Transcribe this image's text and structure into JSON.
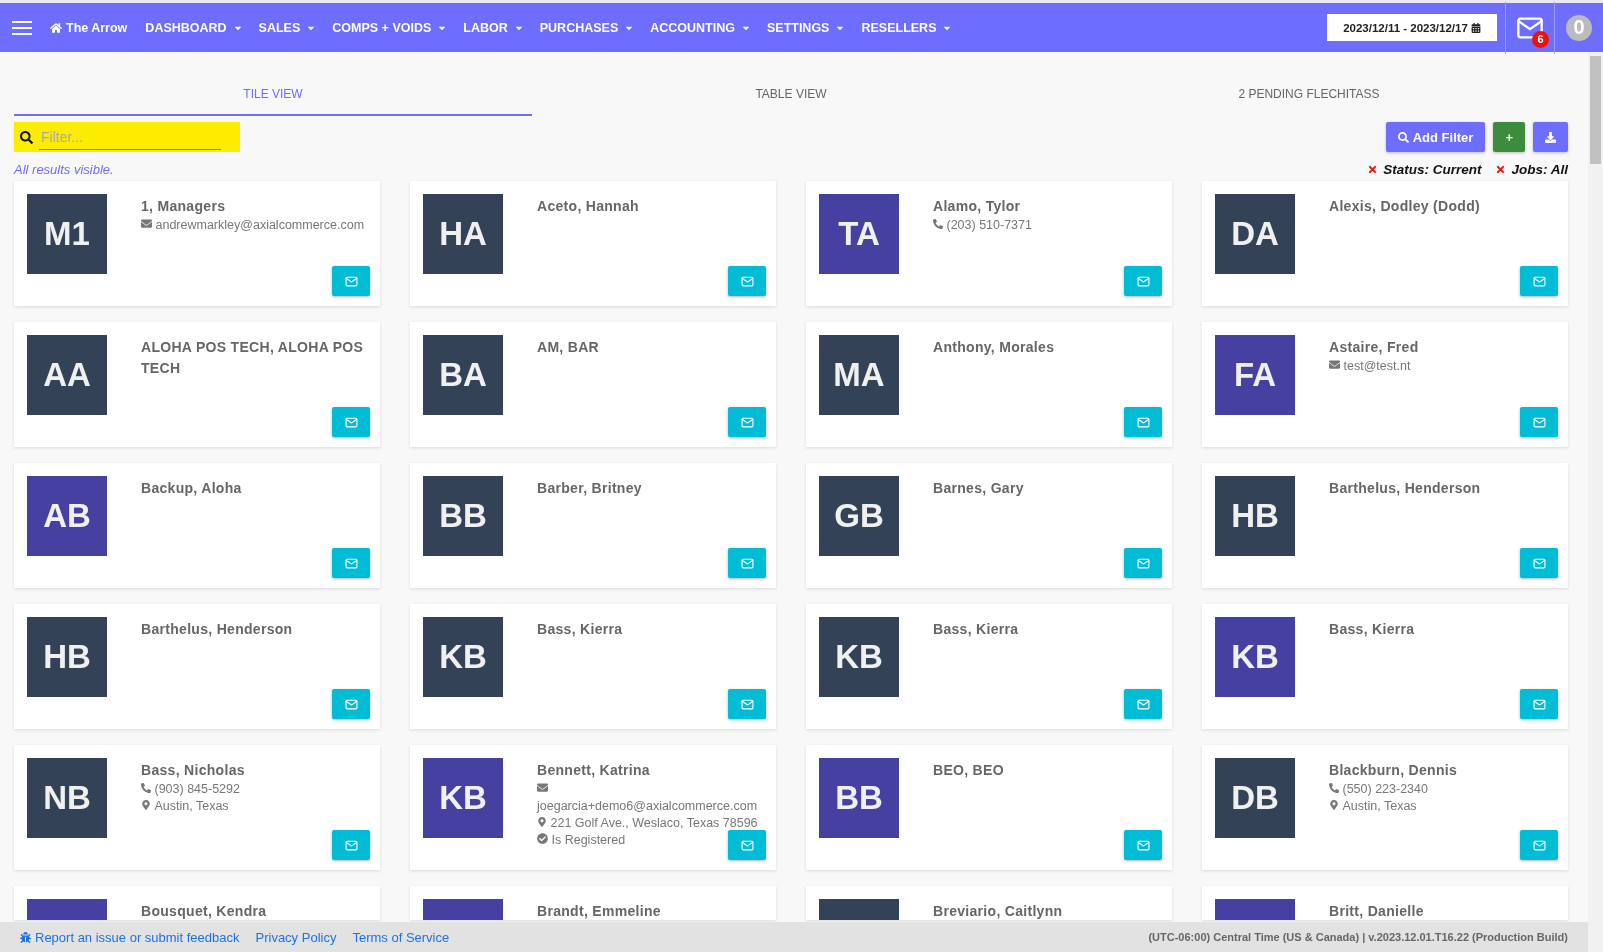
{
  "navbar": {
    "brand": "The Arrow",
    "menus": [
      {
        "label": "DASHBOARD"
      },
      {
        "label": "SALES"
      },
      {
        "label": "COMPS + VOIDS"
      },
      {
        "label": "LABOR"
      },
      {
        "label": "PURCHASES"
      },
      {
        "label": "ACCOUNTING"
      },
      {
        "label": "SETTINGS"
      },
      {
        "label": "RESELLERS"
      }
    ],
    "date_range": "2023/12/11 - 2023/12/17",
    "message_count": "6",
    "user_initial": "0"
  },
  "tabs": [
    {
      "label": "TILE VIEW",
      "selected": true
    },
    {
      "label": "TABLE VIEW",
      "selected": false
    },
    {
      "label": "2 PENDING FLECHITASS",
      "selected": false
    }
  ],
  "filter": {
    "placeholder": "Filter..."
  },
  "toolbar": {
    "add_filter": "Add Filter",
    "add": "+"
  },
  "results_note": "All results visible.",
  "active_filters": [
    "Status: Current",
    "Jobs: All"
  ],
  "tiles": [
    {
      "initials": "M1",
      "name": "1, Managers",
      "color": "#344258",
      "details": [
        {
          "kind": "email",
          "text": "andrewmarkley@axialcommerce.com"
        }
      ]
    },
    {
      "initials": "HA",
      "name": "Aceto, Hannah",
      "color": "#344258"
    },
    {
      "initials": "TA",
      "name": "Alamo, Tylor",
      "color": "#4640a0",
      "details": [
        {
          "kind": "phone",
          "text": "(203) 510-7371"
        }
      ]
    },
    {
      "initials": "DA",
      "name": "Alexis, Dodley (Dodd)",
      "color": "#344258"
    },
    {
      "initials": "AA",
      "name": "ALOHA POS TECH, ALOHA POS TECH",
      "color": "#344258"
    },
    {
      "initials": "BA",
      "name": "AM, BAR",
      "color": "#344258"
    },
    {
      "initials": "MA",
      "name": "Anthony, Morales",
      "color": "#344258"
    },
    {
      "initials": "FA",
      "name": "Astaire, Fred",
      "color": "#4640a0",
      "details": [
        {
          "kind": "email",
          "text": "test@test.nt"
        }
      ]
    },
    {
      "initials": "AB",
      "name": "Backup, Aloha",
      "color": "#4640a0"
    },
    {
      "initials": "BB",
      "name": "Barber, Britney",
      "color": "#344258"
    },
    {
      "initials": "GB",
      "name": "Barnes, Gary",
      "color": "#344258"
    },
    {
      "initials": "HB",
      "name": "Barthelus, Henderson",
      "color": "#344258"
    },
    {
      "initials": "HB",
      "name": "Barthelus, Henderson",
      "color": "#344258"
    },
    {
      "initials": "KB",
      "name": "Bass, Kierra",
      "color": "#344258"
    },
    {
      "initials": "KB",
      "name": "Bass, Kierra",
      "color": "#344258"
    },
    {
      "initials": "KB",
      "name": "Bass, Kierra",
      "color": "#4640a0"
    },
    {
      "initials": "NB",
      "name": "Bass, Nicholas",
      "color": "#344258",
      "details": [
        {
          "kind": "phone",
          "text": "(903) 845-5292"
        },
        {
          "kind": "location",
          "text": "Austin, Texas"
        }
      ]
    },
    {
      "initials": "KB",
      "name": "Bennett, Katrina",
      "color": "#4640a0",
      "details": [
        {
          "kind": "email",
          "text": "joegarcia+demo6@axialcommerce.com"
        },
        {
          "kind": "location",
          "text": "221 Golf Ave., Weslaco, Texas 78596"
        },
        {
          "kind": "registered",
          "text": "Is Registered"
        }
      ]
    },
    {
      "initials": "BB",
      "name": "BEO, BEO",
      "color": "#4640a0"
    },
    {
      "initials": "DB",
      "name": "Blackburn, Dennis",
      "color": "#344258",
      "details": [
        {
          "kind": "phone",
          "text": "(550) 223-2340"
        },
        {
          "kind": "location",
          "text": "Austin, Texas"
        }
      ]
    },
    {
      "name": "Bousquet, Kendra",
      "color": "#4640a0"
    },
    {
      "name": "Brandt, Emmeline",
      "color": "#4640a0"
    },
    {
      "name": "Breviario, Caitlynn",
      "color": "#344258"
    },
    {
      "name": "Britt, Danielle",
      "color": "#4640a0"
    }
  ],
  "footer": {
    "links": [
      "Report an issue or submit feedback",
      "Privacy Policy",
      "Terms of Service"
    ],
    "info": "(UTC-06:00) Central Time (US & Canada) | v.2023.12.01.T16.22 (Production Build)"
  }
}
